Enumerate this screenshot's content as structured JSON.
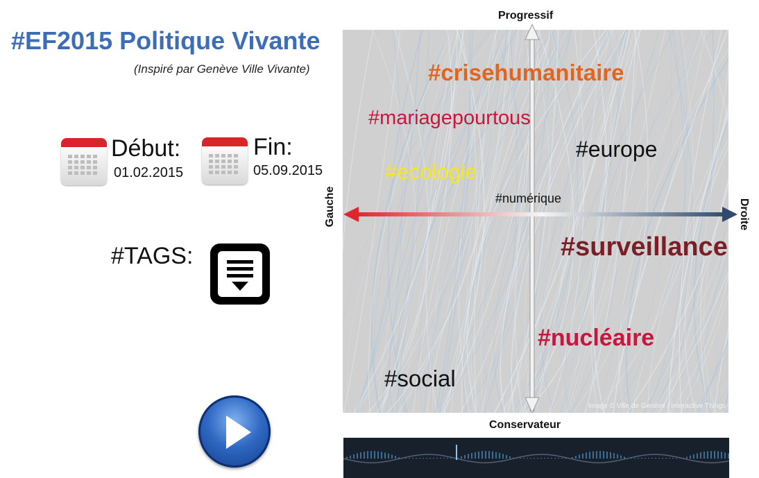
{
  "header": {
    "title": "#EF2015 Politique Vivante",
    "subtitle": "(Inspiré par Genève Ville Vivante)"
  },
  "dates": {
    "start_label": "Début:",
    "start_value": "01.02.2015",
    "end_label": "Fin:",
    "end_value": "05.09.2015"
  },
  "tags_panel": {
    "label": "#TAGS:",
    "icon": "dropdown-list-icon"
  },
  "play": {
    "icon": "play-icon"
  },
  "axes": {
    "top": "Progressif",
    "bottom": "Conservateur",
    "left": "Gauche",
    "right": "Droite"
  },
  "hashtags": [
    {
      "id": "crisehumanitaire",
      "text": "#crisehumanitaire",
      "color": "#e2651f"
    },
    {
      "id": "mariagepourtous",
      "text": "#mariagepourtous",
      "color": "#c8163c"
    },
    {
      "id": "europe",
      "text": "#europe",
      "color": "#111111"
    },
    {
      "id": "ecologie",
      "text": "#ecologie",
      "color": "#f5e52b"
    },
    {
      "id": "numerique",
      "text": "#numérique",
      "color": "#111111"
    },
    {
      "id": "surveillance",
      "text": "#surveillance",
      "color": "#7a1f25"
    },
    {
      "id": "nucleaire",
      "text": "#nucléaire",
      "color": "#c8163c"
    },
    {
      "id": "social",
      "text": "#social",
      "color": "#111111"
    }
  ],
  "map": {
    "credit": "Image © Ville de Genève / Interactive Things"
  },
  "colors": {
    "title_blue": "#3d6db5",
    "left_axis_red": "#e0262d",
    "right_axis_navy": "#2f4a6e",
    "calendar_red": "#d8242a"
  }
}
